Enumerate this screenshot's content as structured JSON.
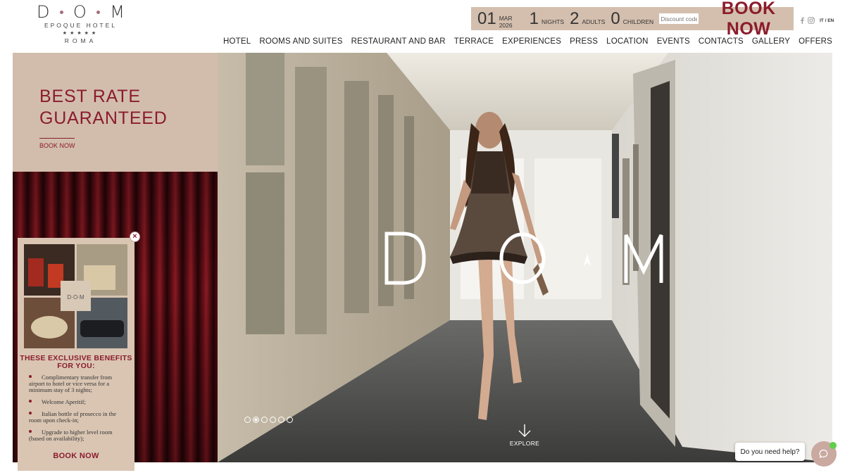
{
  "logo": {
    "letters": [
      "D",
      "O",
      "M"
    ],
    "subtitle": "EPOQUE HOTEL",
    "stars": "★★★★★",
    "city": "ROMA"
  },
  "booking": {
    "day": "01",
    "month_year_label": "MAR 2026",
    "nights_value": "1",
    "nights_label": "NIGHTS",
    "adults_value": "2",
    "adults_label": "ADULTS",
    "children_value": "0",
    "children_label": "CHILDREN",
    "discount_placeholder": "Discount code",
    "book_label": "BOOK NOW"
  },
  "social": {
    "facebook_icon": "facebook-icon",
    "instagram_icon": "instagram-icon",
    "language": "IT / EN"
  },
  "nav": {
    "items": [
      "HOTEL",
      "ROOMS AND SUITES",
      "RESTAURANT AND BAR",
      "TERRACE",
      "EXPERIENCES",
      "PRESS",
      "LOCATION",
      "EVENTS",
      "CONTACTS",
      "GALLERY",
      "OFFERS"
    ]
  },
  "promo": {
    "title_line1": "BEST RATE",
    "title_line2": "GUARANTEED",
    "link": "BOOK NOW"
  },
  "hero": {
    "slide_count": 6,
    "active_slide": 2,
    "explore_label": "EXPLORE"
  },
  "popup": {
    "title": "THESE EXCLUSIVE BENEFITS FOR YOU:",
    "benefits": [
      "Complimentary transfer from airport to hotel or vice versa for a minimum stay of 3 nights;",
      "Welcome Aperitif;",
      "Italian bottle of prosecco in the room upon check-in;",
      "Upgrade to higher level room (based on availability);"
    ],
    "button": "BOOK NOW",
    "close_icon": "close-icon"
  },
  "chat": {
    "prompt": "Do you need help?",
    "icon": "chat-icon"
  },
  "colors": {
    "brand": "#8b1c2c",
    "panel": "#d2bdad",
    "booking_bar": "#d4bfae"
  }
}
